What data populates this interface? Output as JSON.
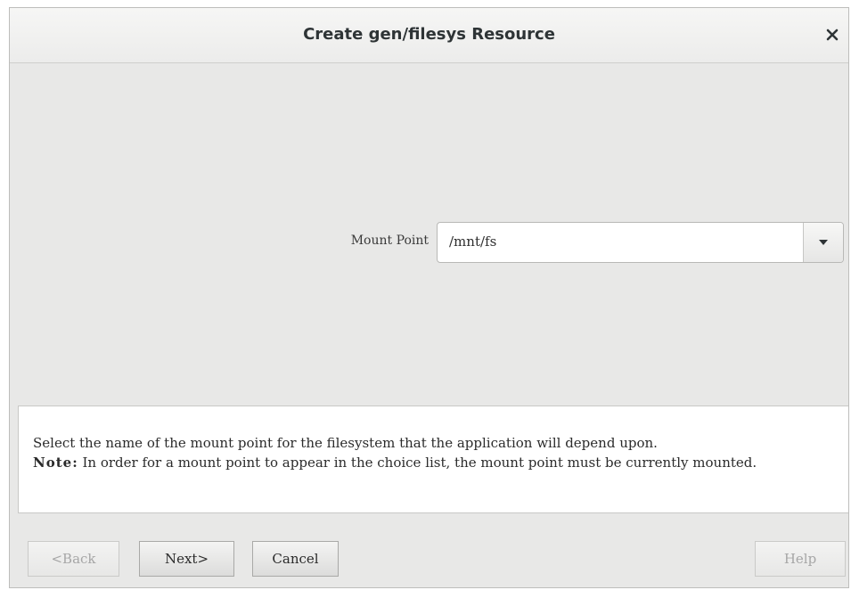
{
  "dialog": {
    "title": "Create gen/filesys Resource",
    "close_label": "×"
  },
  "mount_point": {
    "label": "Mount Point",
    "value": "/mnt/fs"
  },
  "info": {
    "line1": "Select the name of the mount point for the filesystem that the application will depend upon.",
    "note_label": "Note:",
    "note_text": " In order for a mount point to appear in the choice list, the mount point must be currently mounted."
  },
  "buttons": {
    "back": "<Back",
    "next": "Next>",
    "cancel": "Cancel",
    "help": "Help"
  },
  "icons": {
    "close": "close-icon",
    "dropdown": "chevron-down-icon"
  },
  "colors": {
    "dialog_bg": "#e8e8e7",
    "disabled_text": "#a6a6a6"
  }
}
